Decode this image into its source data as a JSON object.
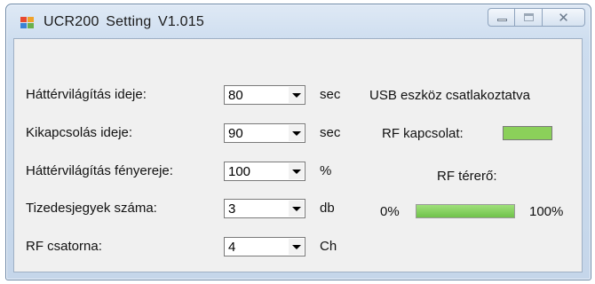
{
  "window": {
    "title": "UCR200  Setting  V1.015",
    "close_glyph": "✕"
  },
  "icons": {
    "app": "app-icon",
    "minimize": "minimize-icon",
    "maximize": "maximize-icon",
    "close": "close-icon"
  },
  "settings": [
    {
      "label": "Háttérvilágítás ideje:",
      "value": "80",
      "unit": "sec"
    },
    {
      "label": "Kikapcsolás ideje:",
      "value": "90",
      "unit": "sec"
    },
    {
      "label": "Háttérvilágítás fényereje:",
      "value": "100",
      "unit": "%"
    },
    {
      "label": "Tizedesjegyek száma:",
      "value": "3",
      "unit": "db"
    },
    {
      "label": "RF csatorna:",
      "value": "4",
      "unit": "Ch"
    }
  ],
  "status": {
    "usb_text": "USB eszköz csatlakoztatva",
    "rf_connection_label": "RF kapcsolat:",
    "rf_indicator_color": "#8bd05a",
    "rf_strength_label": "RF térerő:",
    "min_label": "0%",
    "max_label": "100%",
    "rf_strength_fraction": 1.0
  },
  "colors": {
    "indicator_green": "#8bd05a"
  }
}
